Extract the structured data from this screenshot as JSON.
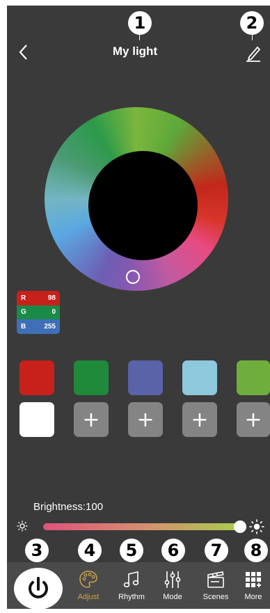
{
  "header": {
    "title": "My light"
  },
  "callouts": {
    "c1": "1",
    "c2": "2",
    "c3": "3",
    "c4": "4",
    "c5": "5",
    "c6": "6",
    "c7": "7",
    "c8": "8"
  },
  "rgb": {
    "r_label": "R",
    "r_value": "98",
    "g_label": "G",
    "g_value": "0",
    "b_label": "B",
    "b_value": "255"
  },
  "swatches": {
    "colors": [
      "#c8201b",
      "#1f8a3a",
      "#5a62a8",
      "#8ec8dc",
      "#6fae3c",
      "#ffffff"
    ],
    "add_label": "+"
  },
  "brightness": {
    "label": "Brightness:100",
    "level": 100
  },
  "tabs": {
    "adjust": "Adjust",
    "rhythm": "Rhythm",
    "mode": "Mode",
    "scenes": "Scenes",
    "more": "More"
  },
  "colors": {
    "background": "#3a3a3a",
    "active_tab": "#cfa34e",
    "bottom_bar": "#4a4a4a"
  },
  "icons": [
    "back-arrow-icon",
    "edit-pencil-icon",
    "power-icon",
    "palette-icon",
    "music-note-icon",
    "sliders-icon",
    "clapperboard-icon",
    "grid-plus-icon",
    "sun-icon"
  ]
}
